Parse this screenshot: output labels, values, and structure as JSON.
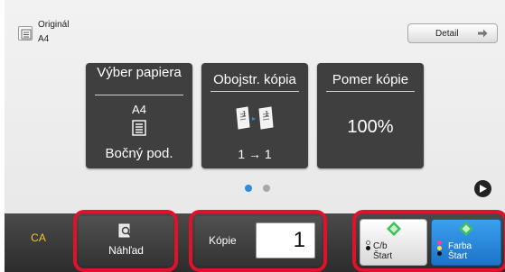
{
  "original": {
    "label": "Originál",
    "size": "A4",
    "icon": "original-document-icon"
  },
  "detail_button": {
    "label": "Detail",
    "icon": "arrow-right-icon"
  },
  "tiles": {
    "paper": {
      "title": "Výber papiera",
      "size": "A4",
      "tray": "Bočný pod.",
      "icon": "paper-tray-icon"
    },
    "duplex": {
      "title": "Obojstr. kópia",
      "mode": "1 → 1",
      "icon": "duplex-copy-icon"
    },
    "ratio": {
      "title": "Pomer kópie",
      "value": "100%"
    }
  },
  "pagination": {
    "current_page": 1,
    "total_pages": 2,
    "next_icon": "chevron-right-icon"
  },
  "bottom": {
    "ca_label": "CA",
    "preview_label": "Náhľad",
    "preview_icon": "preview-magnifier-icon",
    "copies_label": "Kópie",
    "copies_value": "1",
    "start_bw": {
      "line1": "C/b",
      "line2": "Štart",
      "icon": "start-diamond-icon"
    },
    "start_color": {
      "line1": "Farba",
      "line2": "Štart",
      "icon": "start-diamond-icon"
    }
  },
  "colors": {
    "highlight": "#e0112b",
    "accent_blue": "#2d8ee0",
    "ca_yellow": "#f3c534",
    "start_green": "#3fbf5a"
  }
}
